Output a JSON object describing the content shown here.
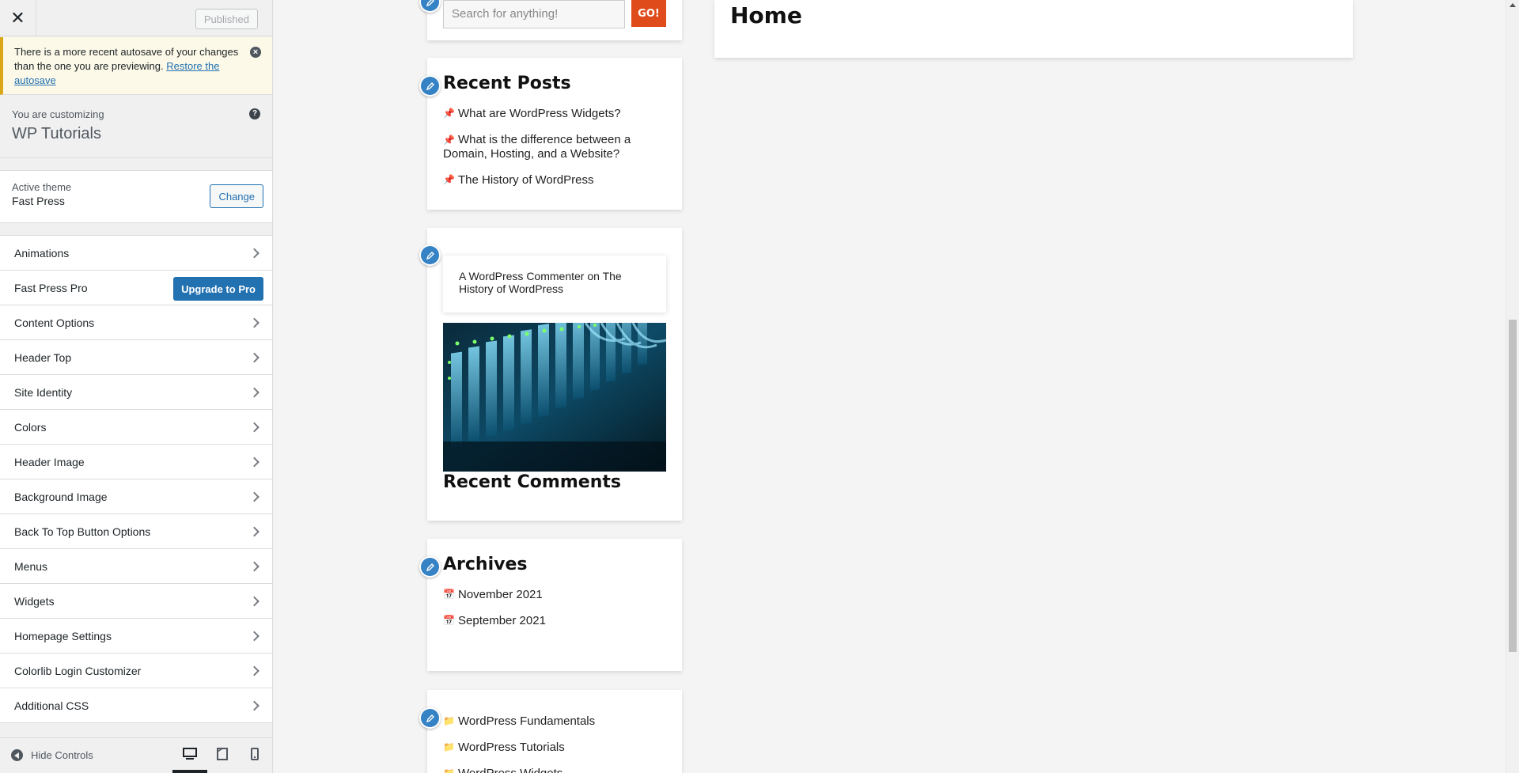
{
  "sidebar": {
    "close_label": "✕",
    "publish_label": "Published",
    "notice": {
      "text": "There is a more recent autosave of your changes than the one you are previewing.",
      "link": "Restore the autosave"
    },
    "customizing": {
      "label": "You are customizing",
      "site_name": "WP Tutorials",
      "help_label": "?"
    },
    "theme": {
      "label": "Active theme",
      "name": "Fast Press",
      "change_label": "Change"
    },
    "sections": [
      {
        "label": "Animations"
      },
      {
        "label": "Fast Press Pro",
        "button": "Upgrade to Pro"
      },
      {
        "label": "Content Options"
      },
      {
        "label": "Header Top"
      },
      {
        "label": "Site Identity"
      },
      {
        "label": "Colors"
      },
      {
        "label": "Header Image"
      },
      {
        "label": "Background Image"
      },
      {
        "label": "Back To Top Button Options"
      },
      {
        "label": "Menus"
      },
      {
        "label": "Widgets"
      },
      {
        "label": "Homepage Settings"
      },
      {
        "label": "Colorlib Login Customizer"
      },
      {
        "label": "Additional CSS"
      }
    ],
    "footer": {
      "hide_controls": "Hide Controls",
      "devices": [
        "desktop-icon",
        "tablet-icon",
        "mobile-icon"
      ],
      "active_device": "desktop"
    }
  },
  "preview": {
    "search": {
      "placeholder": "Search for anything!",
      "button": "GO!"
    },
    "page_title": "Home",
    "recent_posts": {
      "title": "Recent Posts",
      "items": [
        "What are WordPress Widgets?",
        "What is the difference between a Domain, Hosting, and a Website?",
        "The History of WordPress"
      ]
    },
    "recent_comments": {
      "comment_author": "A WordPress Commenter",
      "comment_on": "on",
      "comment_post": "The History of WordPress",
      "title": "Recent Comments"
    },
    "archives": {
      "title": "Archives",
      "items": [
        "November 2021",
        "September 2021"
      ]
    },
    "categories": {
      "items": [
        "WordPress Fundamentals",
        "WordPress Tutorials",
        "WordPress Widgets"
      ]
    }
  },
  "colors": {
    "accent": "#2271b1",
    "notice_border": "#dba617",
    "go_button": "#e04b1b",
    "edit_shortcut": "#3582c4"
  }
}
